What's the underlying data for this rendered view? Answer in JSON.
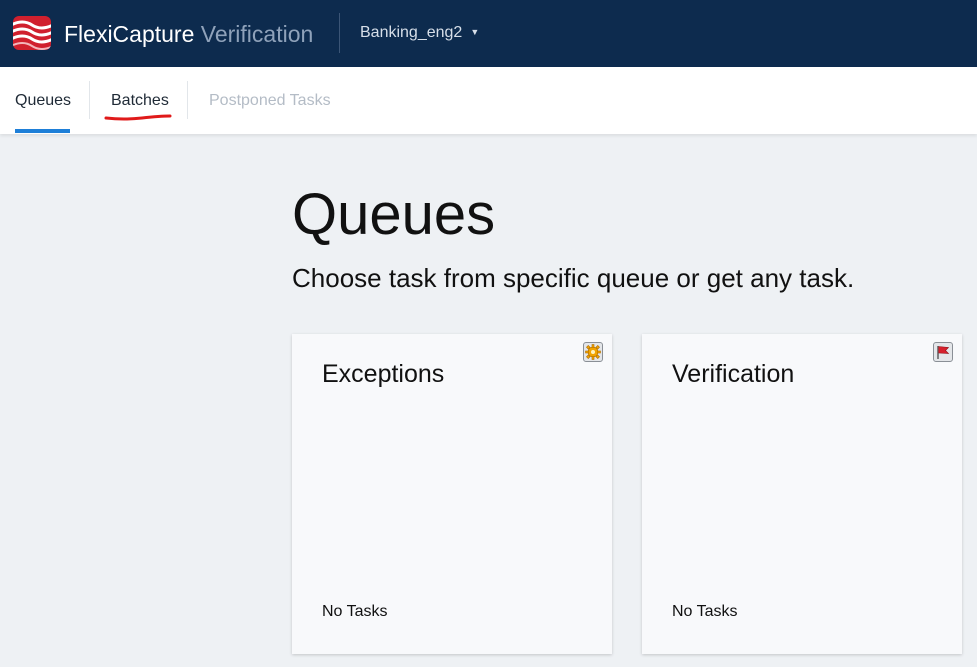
{
  "header": {
    "brand": "FlexiCapture",
    "product": "Verification",
    "project": "Banking_eng2",
    "project_caret_icon": "caret-down-icon",
    "logo_icon": "flexicapture-logo-icon",
    "colors": {
      "bar": "#0d2b4e",
      "logo": "#d0202e",
      "accent": "#1e7fd8"
    }
  },
  "tabs": [
    {
      "label": "Queues",
      "state": "active"
    },
    {
      "label": "Batches",
      "state": "normal"
    },
    {
      "label": "Postponed Tasks",
      "state": "disabled"
    }
  ],
  "main": {
    "title": "Queues",
    "subtitle": "Choose task from specific queue or get any task."
  },
  "cards": [
    {
      "title": "Exceptions",
      "status": "No Tasks",
      "icon": "gear-icon"
    },
    {
      "title": "Verification",
      "status": "No Tasks",
      "icon": "flag-icon"
    }
  ]
}
